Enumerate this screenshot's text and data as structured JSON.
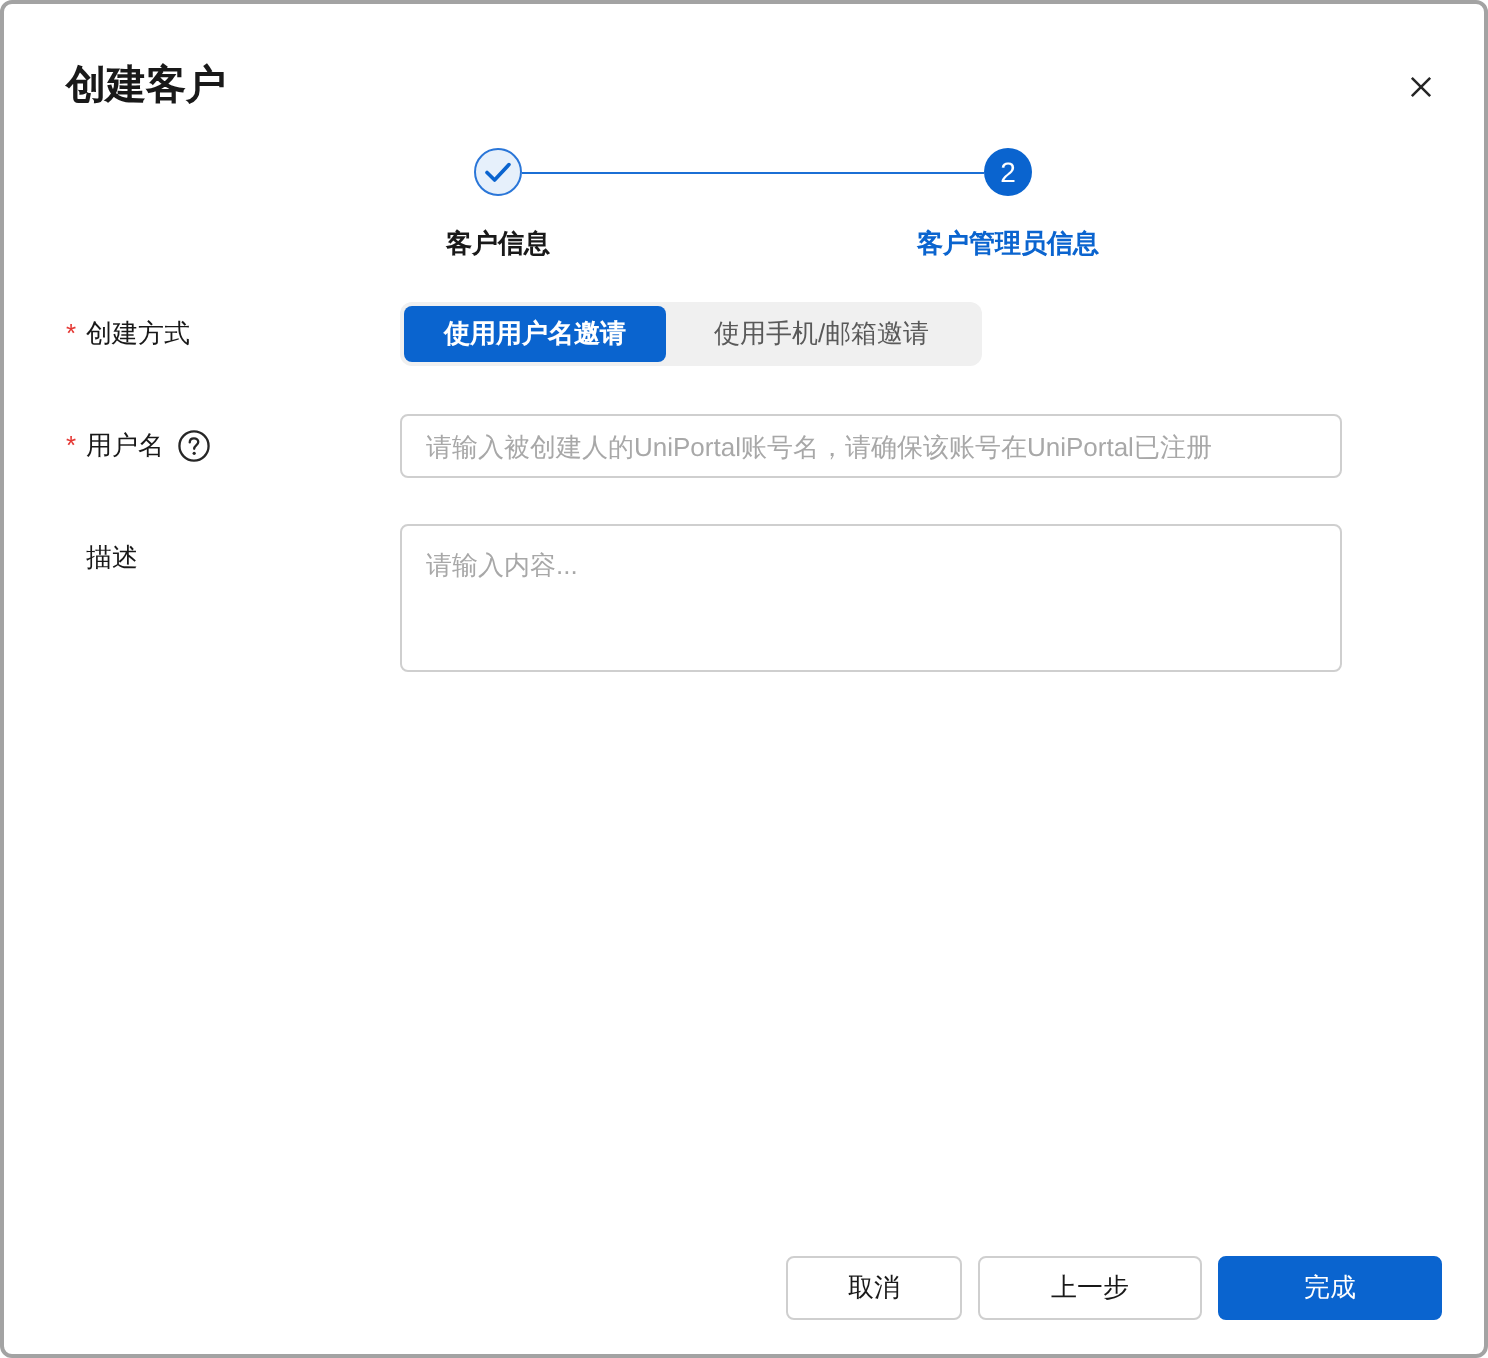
{
  "dialog": {
    "title": "创建客户"
  },
  "steps": [
    {
      "label": "客户信息",
      "done": true,
      "active": false
    },
    {
      "label": "客户管理员信息",
      "number": "2",
      "done": false,
      "active": true
    }
  ],
  "form": {
    "fields": [
      {
        "kind": "segmented",
        "label": "创建方式",
        "required_mark": "*",
        "help": false,
        "options": [
          {
            "label": "使用用户名邀请",
            "selected": true
          },
          {
            "label": "使用手机/邮箱邀请",
            "selected": false
          }
        ]
      },
      {
        "kind": "input",
        "label": "用户名",
        "required_mark": "*",
        "help": true,
        "placeholder": "请输入被创建人的UniPortal账号名，请确保该账号在UniPortal已注册"
      },
      {
        "kind": "textarea",
        "label": "描述",
        "help": false,
        "placeholder": "请输入内容..."
      }
    ]
  },
  "buttons": [
    {
      "label": "取消",
      "kind": "default"
    },
    {
      "label": "上一步",
      "kind": "default"
    },
    {
      "label": "完成",
      "kind": "primary"
    }
  ]
}
